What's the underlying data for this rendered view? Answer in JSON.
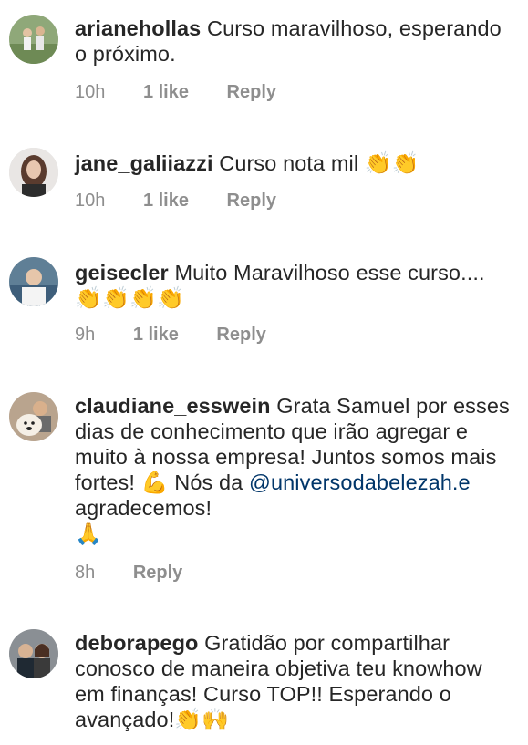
{
  "comments": [
    {
      "username": "arianehollas",
      "text": "Curso maravilhoso, esperando o próximo.",
      "time": "10h",
      "likes": "1 like",
      "reply": "Reply"
    },
    {
      "username": "jane_galiiazzi",
      "text": "Curso nota mil",
      "emoji": "👏👏",
      "time": "10h",
      "likes": "1 like",
      "reply": "Reply"
    },
    {
      "username": "geisecler",
      "text": "Muito Maravilhoso esse curso....",
      "emoji": "👏👏👏👏",
      "time": "9h",
      "likes": "1 like",
      "reply": "Reply"
    },
    {
      "username": "claudiane_esswein",
      "text": "Grata Samuel por esses dias de conhecimento que irão agregar e muito à nossa empresa! Juntos somos mais fortes!",
      "emoji_1": "💪",
      "text_2": "Nós da",
      "mention": "@universodabelezah.e",
      "text_3": "agradecemos!",
      "emoji_2": "🙏",
      "time": "8h",
      "reply": "Reply"
    },
    {
      "username": "deborapego",
      "text": "Gratidão por compartilhar conosco de maneira objetiva teu knowhow em finanças! Curso TOP!! Esperando o avançado!",
      "emoji": "👏🙌"
    }
  ],
  "colors": {
    "text": "#262626",
    "meta": "#8e8e8e",
    "mention": "#003569",
    "background": "#ffffff"
  }
}
